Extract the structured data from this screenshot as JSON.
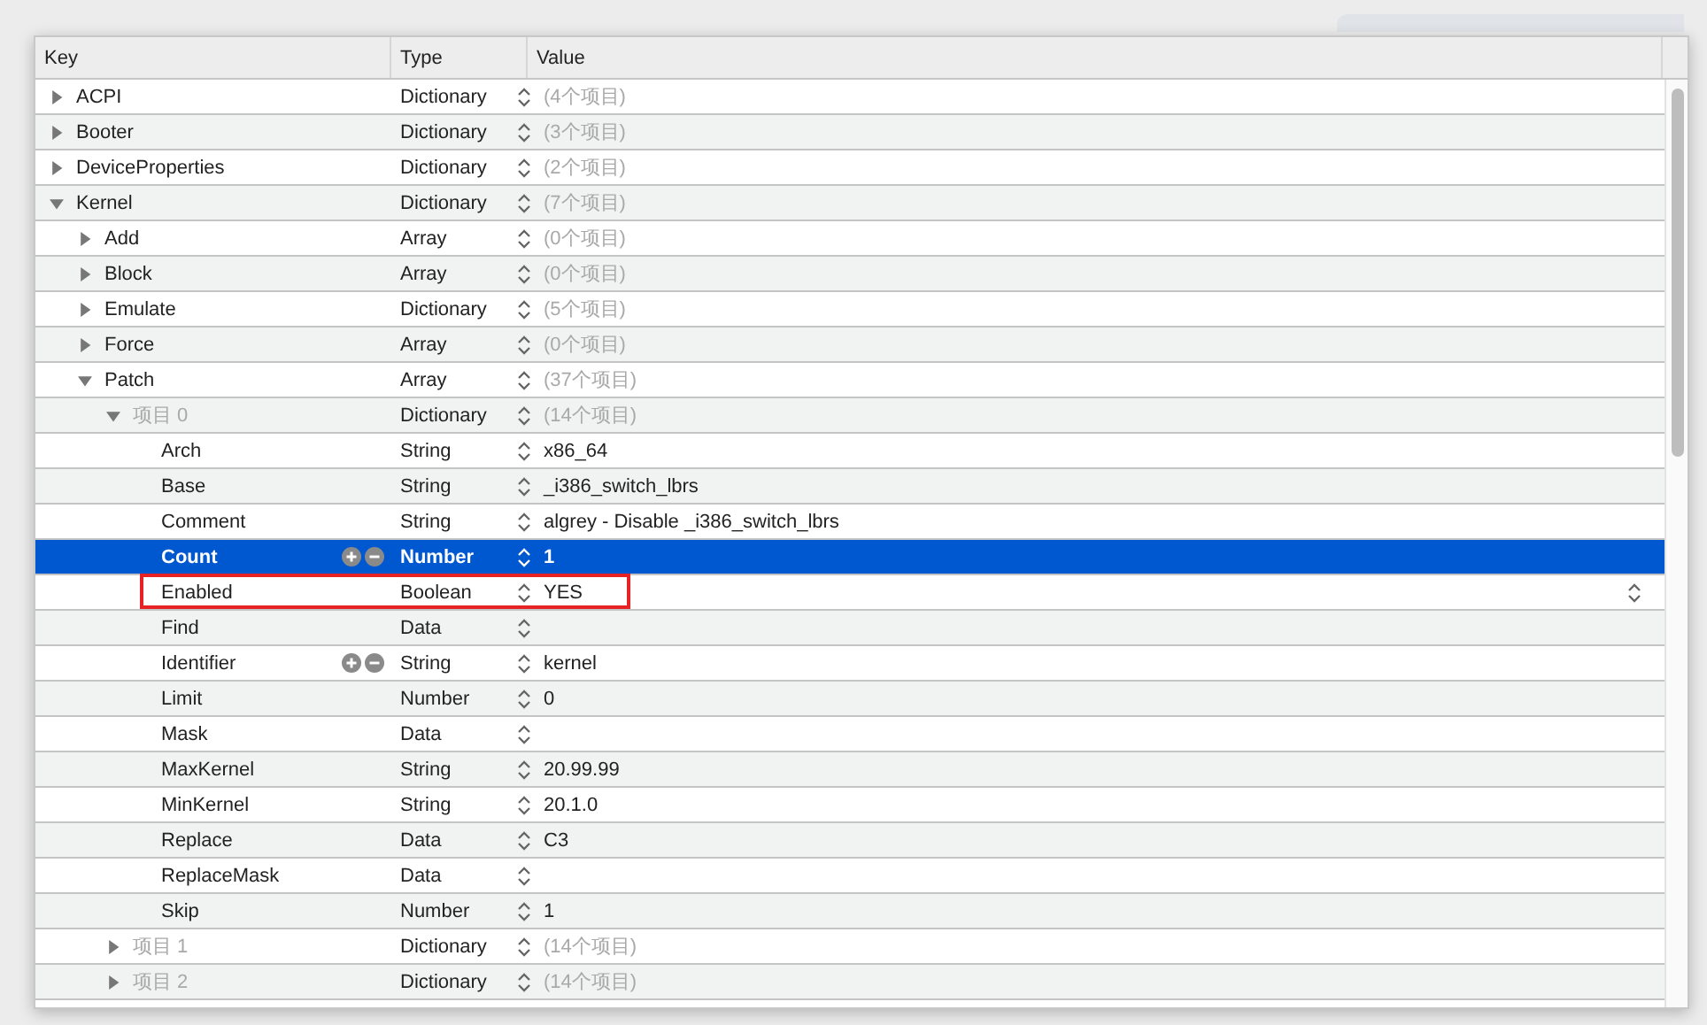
{
  "table": {
    "columns": [
      "Key",
      "Type",
      "Value"
    ],
    "rows": [
      {
        "key": "ACPI",
        "type": "Dictionary",
        "value": "(4个项目)",
        "kind": "group",
        "expanded": false,
        "selected": false,
        "edit_buttons": false,
        "annotated": false
      },
      {
        "key": "Booter",
        "type": "Dictionary",
        "value": "(3个项目)",
        "kind": "group",
        "expanded": false,
        "selected": false,
        "edit_buttons": false,
        "annotated": false
      },
      {
        "key": "DeviceProperties",
        "type": "Dictionary",
        "value": "(2个项目)",
        "kind": "group",
        "expanded": false,
        "selected": false,
        "edit_buttons": false,
        "annotated": false
      },
      {
        "key": "Kernel",
        "type": "Dictionary",
        "value": "(7个项目)",
        "kind": "group",
        "expanded": true,
        "selected": false,
        "edit_buttons": false,
        "annotated": false,
        "children": [
          {
            "key": "Add",
            "type": "Array",
            "value": "(0个项目)",
            "kind": "group",
            "expanded": false,
            "selected": false,
            "edit_buttons": false,
            "annotated": false
          },
          {
            "key": "Block",
            "type": "Array",
            "value": "(0个项目)",
            "kind": "group",
            "expanded": false,
            "selected": false,
            "edit_buttons": false,
            "annotated": false
          },
          {
            "key": "Emulate",
            "type": "Dictionary",
            "value": "(5个项目)",
            "kind": "group",
            "expanded": false,
            "selected": false,
            "edit_buttons": false,
            "annotated": false
          },
          {
            "key": "Force",
            "type": "Array",
            "value": "(0个项目)",
            "kind": "group",
            "expanded": false,
            "selected": false,
            "edit_buttons": false,
            "annotated": false
          },
          {
            "key": "Patch",
            "type": "Array",
            "value": "(37个项目)",
            "kind": "group",
            "expanded": true,
            "selected": false,
            "edit_buttons": false,
            "annotated": false,
            "children": [
              {
                "key": "项目 0",
                "type": "Dictionary",
                "value": "(14个项目)",
                "kind": "element",
                "expanded": true,
                "selected": false,
                "edit_buttons": false,
                "annotated": false,
                "children": [
                  {
                    "key": "Arch",
                    "type": "String",
                    "value": "x86_64",
                    "kind": "field",
                    "selected": false,
                    "edit_buttons": false,
                    "annotated": false
                  },
                  {
                    "key": "Base",
                    "type": "String",
                    "value": "_i386_switch_lbrs",
                    "kind": "field",
                    "selected": false,
                    "edit_buttons": false,
                    "annotated": false
                  },
                  {
                    "key": "Comment",
                    "type": "String",
                    "value": "algrey - Disable _i386_switch_lbrs",
                    "kind": "field",
                    "selected": false,
                    "edit_buttons": false,
                    "annotated": false
                  },
                  {
                    "key": "Count",
                    "type": "Number",
                    "value": "1",
                    "kind": "field",
                    "selected": true,
                    "edit_buttons": true,
                    "annotated": false
                  },
                  {
                    "key": "Enabled",
                    "type": "Boolean",
                    "value": "YES",
                    "kind": "field",
                    "selected": false,
                    "edit_buttons": false,
                    "annotated": true
                  },
                  {
                    "key": "Find",
                    "type": "Data",
                    "kind": "field",
                    "selected": false,
                    "edit_buttons": false,
                    "annotated": false
                  },
                  {
                    "key": "Identifier",
                    "type": "String",
                    "value": "kernel",
                    "kind": "field",
                    "selected": false,
                    "edit_buttons": true,
                    "annotated": false
                  },
                  {
                    "key": "Limit",
                    "type": "Number",
                    "value": "0",
                    "kind": "field",
                    "selected": false,
                    "edit_buttons": false,
                    "annotated": false
                  },
                  {
                    "key": "Mask",
                    "type": "Data",
                    "kind": "field",
                    "selected": false,
                    "edit_buttons": false,
                    "annotated": false
                  },
                  {
                    "key": "MaxKernel",
                    "type": "String",
                    "value": "20.99.99",
                    "kind": "field",
                    "selected": false,
                    "edit_buttons": false,
                    "annotated": false
                  },
                  {
                    "key": "MinKernel",
                    "type": "String",
                    "value": "20.1.0",
                    "kind": "field",
                    "selected": false,
                    "edit_buttons": false,
                    "annotated": false
                  },
                  {
                    "key": "Replace",
                    "type": "Data",
                    "value": "C3",
                    "kind": "field",
                    "selected": false,
                    "edit_buttons": false,
                    "annotated": false
                  },
                  {
                    "key": "ReplaceMask",
                    "type": "Data",
                    "kind": "field",
                    "selected": false,
                    "edit_buttons": false,
                    "annotated": false
                  },
                  {
                    "key": "Skip",
                    "type": "Number",
                    "value": "1",
                    "kind": "field",
                    "selected": false,
                    "edit_buttons": false,
                    "annotated": false
                  }
                ]
              },
              {
                "key": "项目 1",
                "type": "Dictionary",
                "value": "(14个项目)",
                "kind": "element",
                "expanded": false,
                "selected": false,
                "edit_buttons": false,
                "annotated": false
              },
              {
                "key": "项目 2",
                "type": "Dictionary",
                "value": "(14个项目)",
                "kind": "element",
                "expanded": false,
                "selected": false,
                "edit_buttons": false,
                "annotated": false
              }
            ]
          }
        ]
      }
    ]
  }
}
